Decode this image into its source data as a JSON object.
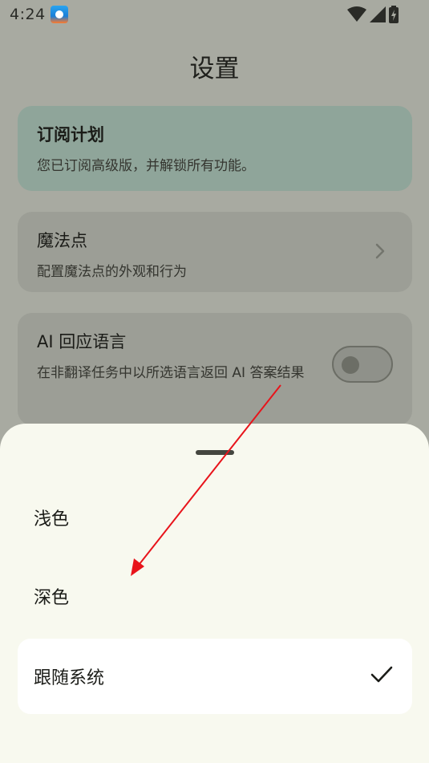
{
  "status_bar": {
    "time": "4:24",
    "app_icon": "app-notification-icon",
    "icons": [
      "wifi-icon",
      "signal-icon",
      "battery-charging-icon"
    ]
  },
  "page": {
    "title": "设置"
  },
  "subscription": {
    "title": "订阅计划",
    "description": "您已订阅高级版，并解锁所有功能。"
  },
  "magic_dot": {
    "title": "魔法点",
    "description": "配置魔法点的外观和行为",
    "icon": "chevron-right-icon"
  },
  "ai_language": {
    "title": "AI 回应语言",
    "description": "在非翻译任务中以所选语言返回 AI 答案结果",
    "enabled": false
  },
  "theme_sheet": {
    "options": [
      {
        "label": "浅色",
        "selected": false
      },
      {
        "label": "深色",
        "selected": false
      },
      {
        "label": "跟随系统",
        "selected": true
      }
    ],
    "selected_icon": "check-icon"
  },
  "colors": {
    "annotation_arrow": "#e8141b",
    "sheet_background": "#f8f9ef",
    "subscription_card": "#8fa59a"
  }
}
